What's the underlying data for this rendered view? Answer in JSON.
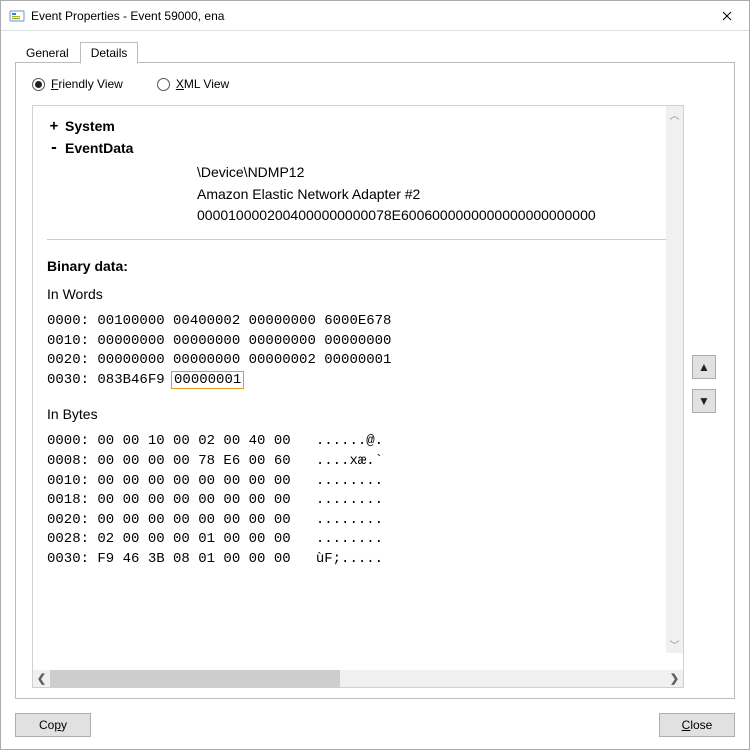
{
  "window": {
    "title": "Event Properties - Event 59000, ena"
  },
  "tabs": {
    "general": "General",
    "details": "Details",
    "active": "details"
  },
  "view": {
    "friendly_label_pre": "F",
    "friendly_label_post": "riendly View",
    "xml_label_pre": "X",
    "xml_label_post": "ML View"
  },
  "tree": {
    "system": {
      "toggle": "+",
      "label": "System"
    },
    "eventdata": {
      "toggle": "-",
      "label": "EventData"
    }
  },
  "eventdata": {
    "v0": "\\Device\\NDMP12",
    "v1": "Amazon Elastic Network Adapter #2",
    "v2": "0000100002004000000000078E6006000000000000000000000"
  },
  "binary": {
    "title": "Binary data:",
    "words_label": "In Words",
    "bytes_label": "In Bytes",
    "words_l0": "0000: 00100000 00400002 00000000 6000E678",
    "words_l1": "0010: 00000000 00000000 00000000 00000000",
    "words_l2": "0020: 00000000 00000000 00000002 00000001",
    "words_l3_pre": "0030: 083B46F9 ",
    "words_l3_hl": "00000001",
    "bytes_l0": "0000: 00 00 10 00 02 00 40 00   ......@.",
    "bytes_l1": "0008: 00 00 00 00 78 E6 00 60   ....xæ.`",
    "bytes_l2": "0010: 00 00 00 00 00 00 00 00   ........",
    "bytes_l3": "0018: 00 00 00 00 00 00 00 00   ........",
    "bytes_l4": "0020: 00 00 00 00 00 00 00 00   ........",
    "bytes_l5": "0028: 02 00 00 00 01 00 00 00   ........",
    "bytes_l6": "0030: F9 46 3B 08 01 00 00 00   ùF;....."
  },
  "buttons": {
    "copy_pre": "Co",
    "copy_u": "p",
    "copy_post": "y",
    "close_pre": "",
    "close_u": "C",
    "close_post": "lose"
  }
}
